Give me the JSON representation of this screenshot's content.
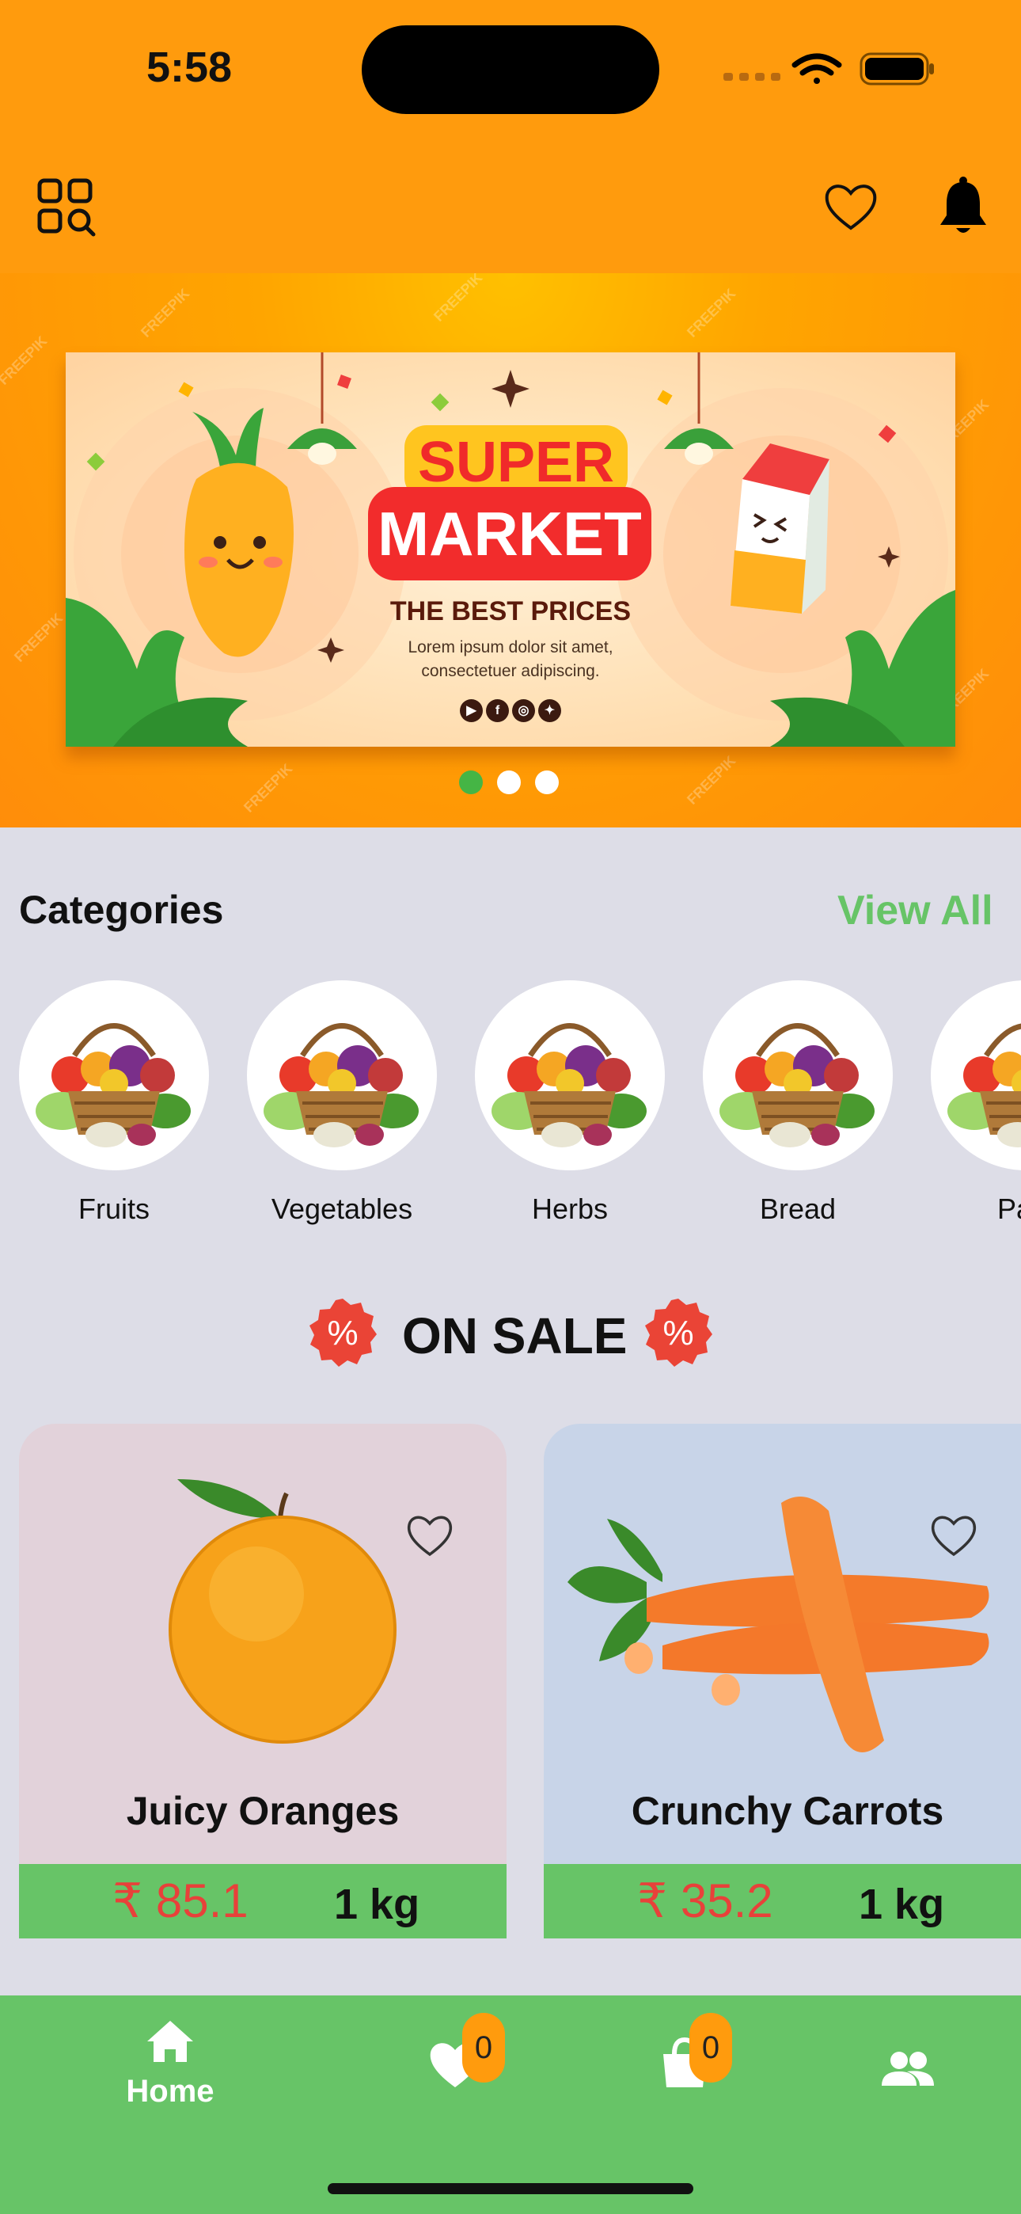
{
  "status_bar": {
    "time": "5:58"
  },
  "header": {
    "menu_icon": "grid-search-icon",
    "wishlist_icon": "heart-outline-icon",
    "notifications_icon": "bell-icon"
  },
  "banner": {
    "title_line1": "SUPER",
    "title_line2": "MARKET",
    "subtitle": "THE BEST PRICES",
    "body_line1": "Lorem ipsum dolor sit amet,",
    "body_line2": "consectetuer adipiscing.",
    "watermark": "FREEPIK",
    "social_icons": [
      "youtube-icon",
      "facebook-icon",
      "instagram-icon",
      "twitter-icon"
    ],
    "carousel": {
      "total": 3,
      "active_index": 0
    }
  },
  "categories": {
    "title": "Categories",
    "view_all": "View All",
    "items": [
      {
        "label": "Fruits"
      },
      {
        "label": "Vegetables"
      },
      {
        "label": "Herbs"
      },
      {
        "label": "Bread"
      },
      {
        "label": "Past"
      }
    ]
  },
  "on_sale": {
    "title": "ON SALE",
    "badge_symbol": "%",
    "products": [
      {
        "name": "Juicy Oranges",
        "price": "₹ 85.1",
        "unit": "1 kg",
        "background": "#e2d2da"
      },
      {
        "name": "Crunchy Carrots",
        "price": "₹ 35.2",
        "unit": "1 kg",
        "background": "#c8d4e8"
      }
    ]
  },
  "bottom_nav": {
    "home_label": "Home",
    "wishlist_count": "0",
    "cart_count": "0",
    "items": [
      "home-icon",
      "heart-icon",
      "shopping-bag-icon",
      "users-icon"
    ]
  },
  "colors": {
    "primary_orange": "#ff9b0d",
    "accent_green": "#67c467",
    "sale_red": "#e8413a",
    "background": "#dddde7"
  }
}
